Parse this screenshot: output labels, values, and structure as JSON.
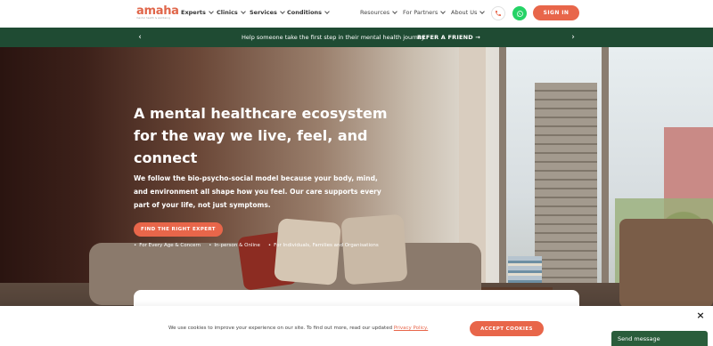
{
  "brand": {
    "name": "amaha",
    "tagline": "mental health & wellbeing",
    "accent_color": "#e8664a",
    "banner_color": "#1f4b33"
  },
  "nav": {
    "items": [
      {
        "label": "Experts"
      },
      {
        "label": "Clinics"
      },
      {
        "label": "Services"
      },
      {
        "label": "Conditions"
      }
    ],
    "right_items": [
      {
        "label": "Resources"
      },
      {
        "label": "For Partners"
      },
      {
        "label": "About Us"
      }
    ],
    "phone_icon": "phone-icon",
    "whatsapp_icon": "whatsapp-icon",
    "signin_label": "SIGN IN"
  },
  "banner": {
    "text": "Help someone take the first step in their mental health journey.",
    "cta": "REFER A FRIEND",
    "prev_icon": "chevron-left-icon",
    "next_icon": "chevron-right-icon"
  },
  "hero": {
    "title": "A mental healthcare ecosystem for the way we live, feel, and connect",
    "subtitle": "We follow the bio-psycho-social model because your body, mind, and environment all shape how you feel. Our care supports every part of your life, not just symptoms.",
    "cta": "FIND THE RIGHT EXPERT",
    "bullets": [
      "For Every Age & Concern",
      "In-person & Online",
      "For Individuals, Families and Organisations"
    ]
  },
  "cookie": {
    "text": "We use cookies to improve your experience on our site. To find out more, read our updated ",
    "link": "Privacy Policy.",
    "accept": "ACCEPT COOKIES",
    "close": "×"
  },
  "chat": {
    "label": "Send message"
  }
}
